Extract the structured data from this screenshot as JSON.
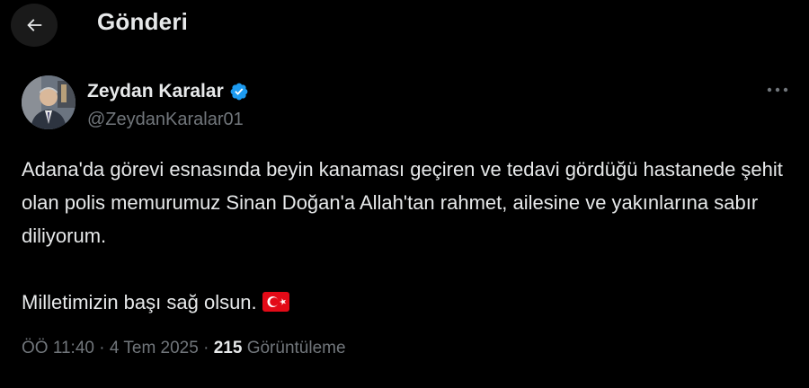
{
  "header": {
    "title": "Gönderi",
    "back_icon": "arrow-left-icon"
  },
  "author": {
    "name": "Zeydan Karalar",
    "handle": "@ZeydanKaralar01",
    "verified_color": "#1d9bf0",
    "more_icon": "more-horizontal-icon"
  },
  "tweet": {
    "paragraph1": "Adana'da görevi esnasında beyin kanaması geçiren ve tedavi gördüğü hastanede şehit olan polis memurumuz Sinan Doğan'a Allah'tan rahmet, ailesine ve yakınlarına sabır diliyorum.",
    "paragraph2": "Milletimizin başı sağ olsun.",
    "flag_icon": "turkish-flag-icon"
  },
  "meta": {
    "time": "ÖÖ 11:40",
    "separator": "·",
    "date": "4 Tem 2025",
    "views_count": "215",
    "views_label": "Görüntüleme"
  },
  "colors": {
    "background": "#000000",
    "primary_text": "#e7e9ea",
    "secondary_text": "#71767b",
    "accent": "#1d9bf0"
  }
}
